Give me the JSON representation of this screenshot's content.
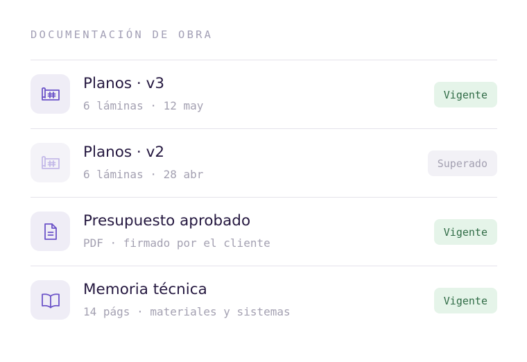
{
  "section": {
    "heading": "DOCUMENTACIÓN DE OBRA"
  },
  "documents": [
    {
      "title": "Planos · v3",
      "meta": "6 láminas · 12 may",
      "icon": "blueprint-icon",
      "status": "Vigente"
    },
    {
      "title": "Planos · v2",
      "meta": "6 láminas · 28 abr",
      "icon": "blueprint-icon",
      "status": "Superado"
    },
    {
      "title": "Presupuesto aprobado",
      "meta": "PDF · firmado por el cliente",
      "icon": "document-icon",
      "status": "Vigente"
    },
    {
      "title": "Memoria técnica",
      "meta": "14 págs · materiales y sistemas",
      "icon": "open-book-icon",
      "status": "Vigente"
    }
  ],
  "colors": {
    "icon_accent": "#6b52c8",
    "vigente_bg": "#e5f4e9",
    "vigente_text": "#2f6b45",
    "superado_bg": "#f2f1f6",
    "superado_text": "#a3a0b1"
  }
}
